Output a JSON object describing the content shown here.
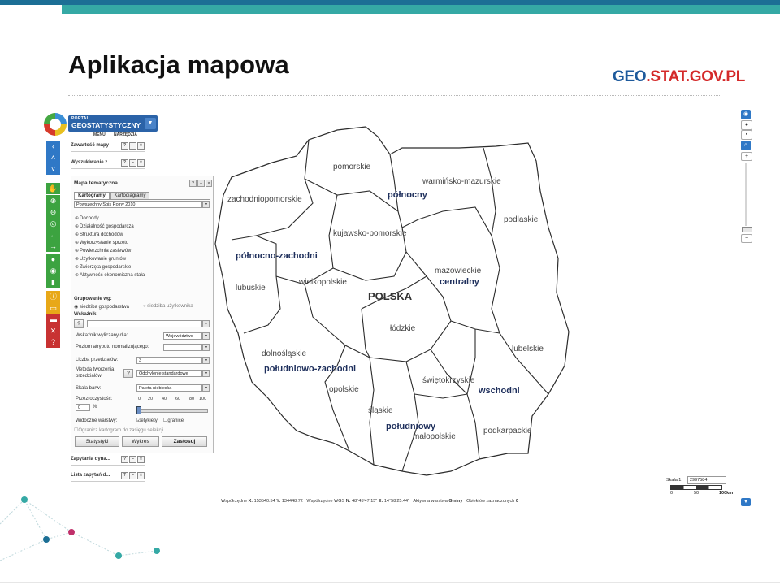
{
  "slide": {
    "title": "Aplikacja mapowa",
    "logo_text_a": "GEO",
    "logo_text_b": ".STAT.GOV.PL"
  },
  "portal": {
    "brand_small": "PORTAL",
    "brand_big": "GEOSTATYSTYCZNY",
    "menu": "MENU",
    "tools": "NARZĘDZIA"
  },
  "panels": {
    "map_content": "Zawartość mapy",
    "search": "Wyszukiwanie z...",
    "dynamic_queries": "Zapytania dyna...",
    "query_list": "Lista zapytań d..."
  },
  "theme": {
    "title": "Mapa tematyczna",
    "tab_cartograms": "Kartogramy",
    "tab_cartodiagrams": "Kartodiagramy",
    "dataset": "Powszechny Spis Rolny 2010",
    "tree": [
      "Dochody",
      "Działalność gospodarcza",
      "Struktura dochodów",
      "Wykorzystanie sprzętu",
      "Powierzchnia zasiewów",
      "Użytkowanie gruntów",
      "Zwierzęta gospodarskie",
      "Aktywność ekonomiczna stała"
    ],
    "grouping_label": "Grupowanie wg:",
    "grouping_opt1": "siedziba gospodarstwa",
    "grouping_opt2": "siedziba użytkownika",
    "indicator_label": "Wskaźnik:",
    "calc_for_label": "Wskaźnik wyliczany dla:",
    "calc_for_value": "Województwo",
    "norm_label": "Poziom atrybutu normalizującego:",
    "classes_label": "Liczba przedziałów:",
    "classes_value": "3",
    "method_label_1": "Metoda tworzenia",
    "method_label_2": "przedziałów:",
    "method_value": "Odchylenie standardowe",
    "palette_label": "Skala barw:",
    "palette_value": "Paleta niebieska",
    "transparency_label": "Przezroczystość:",
    "transparency_value": "0",
    "transparency_unit": "%",
    "ticks": [
      "0",
      "20",
      "40",
      "60",
      "80",
      "100"
    ],
    "layers_label": "Widoczne warstwy:",
    "layer_labels": "etykiety",
    "layer_borders": "granice",
    "restrict_label": "Ogranicz kartogram do zasięgu selekcji",
    "btn_stats": "Statystyki",
    "btn_chart": "Wykres",
    "btn_apply": "Zastosuj"
  },
  "map": {
    "country": "POLSKA",
    "regions": [
      "pomorskie",
      "warmińsko-mazurskie",
      "zachodniopomorskie",
      "podlaskie",
      "kujawsko-pomorskie",
      "lubuskie",
      "wielkopolskie",
      "mazowieckie",
      "łódzkie",
      "dolnośląskie",
      "lubelskie",
      "opolskie",
      "świętokrzyskie",
      "śląskie",
      "małopolskie",
      "podkarpackie"
    ],
    "macroregions": [
      "północny",
      "północno-zachodni",
      "centralny",
      "południowo-zachodni",
      "wschodni",
      "południowy"
    ]
  },
  "scale": {
    "label": "Skala 1:",
    "value": "2997584",
    "ticks": [
      "0",
      "50",
      "100km"
    ]
  },
  "status": {
    "coord_label": "Współrzędne",
    "x_label": "X:",
    "x_value": "153540.54",
    "y_label": "Y:",
    "y_value": "134448.72",
    "wgs_label": "Współrzędne WGS",
    "n_label": "N:",
    "n_value": "48°45'47.15\"",
    "e_label": "E:",
    "e_value": "14°58'25.44\"",
    "layer_label": "Aktywna warstwa",
    "layer_value": "Gminy",
    "selected_label": "Obiektów zaznaczonych",
    "selected_value": "0"
  },
  "colors": {
    "top_dark": "#1c6f95",
    "top_teal": "#35a9a5",
    "brand_blue": "#2b63a8",
    "logo_red": "#d42a2a"
  }
}
